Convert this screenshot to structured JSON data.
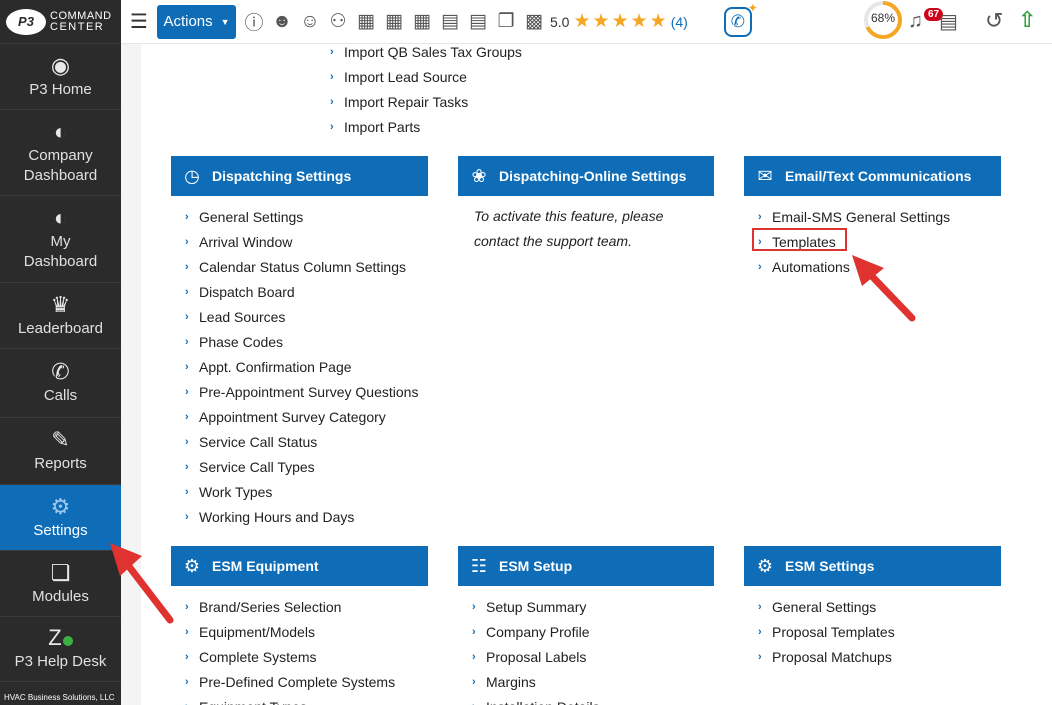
{
  "sidebar": {
    "logo_mark": "P3",
    "logo_line1": "COMMAND",
    "logo_line2": "CENTER",
    "items": [
      {
        "label": "P3 Home",
        "icon": "p3-logo-icon"
      },
      {
        "label": "Company Dashboard",
        "icon": "gauge-icon"
      },
      {
        "label": "My Dashboard",
        "icon": "gauge-icon"
      },
      {
        "label": "Leaderboard",
        "icon": "trophy-icon"
      },
      {
        "label": "Calls",
        "icon": "phone-icon"
      },
      {
        "label": "Reports",
        "icon": "report-icon"
      },
      {
        "label": "Settings",
        "icon": "gear-icon",
        "active": true
      },
      {
        "label": "Modules",
        "icon": "cubes-icon"
      },
      {
        "label": "P3 Help Desk",
        "icon": "zendesk-icon"
      }
    ],
    "footer": "HVAC Business Solutions, LLC"
  },
  "topbar": {
    "actions_label": "Actions",
    "rating_value": "5.0",
    "rating_stars": 5,
    "rating_count": "(4)",
    "progress_label": "68%",
    "progress": 0.68,
    "notifications": "67"
  },
  "top_links": [
    "Import QB Sales Tax Groups",
    "Import Lead Source",
    "Import Repair Tasks",
    "Import Parts"
  ],
  "cards": {
    "dispatch": {
      "title": "Dispatching Settings",
      "items": [
        "General Settings",
        "Arrival Window",
        "Calendar Status Column Settings",
        "Dispatch Board",
        "Lead Sources",
        "Phase Codes",
        "Appt. Confirmation Page",
        "Pre-Appointment Survey Questions",
        "Appointment Survey Category",
        "Service Call Status",
        "Service Call Types",
        "Work Types",
        "Working Hours and Days"
      ]
    },
    "online": {
      "title": "Dispatching-Online Settings",
      "info": "To activate this feature, please contact the support team."
    },
    "email": {
      "title": "Email/Text Communications",
      "items": [
        "Email-SMS General Settings",
        "Templates",
        "Automations"
      ]
    },
    "esm_equipment": {
      "title": "ESM Equipment",
      "items": [
        "Brand/Series Selection",
        "Equipment/Models",
        "Complete Systems",
        "Pre-Defined Complete Systems",
        "Equipment Types"
      ]
    },
    "esm_setup": {
      "title": "ESM Setup",
      "items": [
        "Setup Summary",
        "Company Profile",
        "Proposal Labels",
        "Margins",
        "Installation Details"
      ]
    },
    "esm_settings": {
      "title": "ESM Settings",
      "items": [
        "General Settings",
        "Proposal Templates",
        "Proposal Matchups"
      ]
    }
  },
  "colors": {
    "brand_blue": "#0f6db8",
    "sidebar_bg": "#2b2b2b",
    "star": "#f5a623",
    "annotation_red": "#e0322e",
    "upload_green": "#2e9e3b"
  }
}
